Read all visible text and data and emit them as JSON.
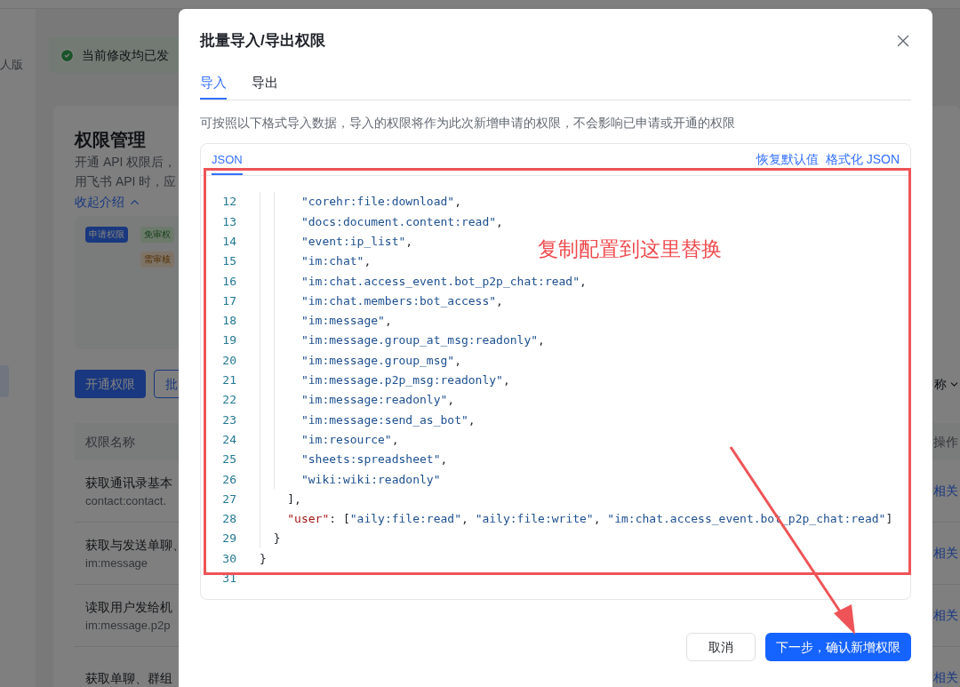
{
  "background_page": {
    "sidebar_label": "人版",
    "banner": {
      "text": "当前修改均已发"
    },
    "card": {
      "title": "权限管理",
      "description_lines": [
        "开通 API 权限后，",
        "用飞书 API 时，应"
      ],
      "collapse_link": "收起介绍",
      "tags": [
        {
          "label": "申请权限",
          "kind": "apply"
        },
        {
          "label": "免审权",
          "kind": "exempt"
        },
        {
          "label": "需审核",
          "kind": "review"
        }
      ],
      "buttons": [
        {
          "label": "开通权限",
          "kind": "primary"
        },
        {
          "label": "批",
          "kind": "outline"
        }
      ],
      "sort_label": "称",
      "table": {
        "columns": [
          "权限名称",
          "操作"
        ],
        "rows": [
          {
            "name": "获取通讯录基本",
            "scope": "contact:contact.",
            "action": "相关"
          },
          {
            "name": "获取与发送单聊、",
            "scope": "im:message",
            "action": "相关"
          },
          {
            "name": "读取用户发给机",
            "scope": "im:message.p2p",
            "action": "相关"
          },
          {
            "name": "获取单聊、群组",
            "action": "相关"
          }
        ]
      }
    }
  },
  "dialog": {
    "title": "批量导入/导出权限",
    "tabs": [
      {
        "label": "导入",
        "selected": true
      },
      {
        "label": "导出",
        "selected": false
      }
    ],
    "description": "可按照以下格式导入数据，导入的权限将作为此次新增申请的权限，不会影响已申请或开通的权限",
    "editor": {
      "tab": {
        "label": "JSON",
        "selected": true
      },
      "actions": [
        "恢复默认值",
        "格式化 JSON"
      ],
      "lines": [
        {
          "number": "12",
          "kind": "array_item",
          "tokens": [
            {
              "kind": "string",
              "text": "\"corehr:file:download\""
            },
            {
              "kind": "punct",
              "text": ","
            }
          ]
        },
        {
          "number": "13",
          "kind": "array_item",
          "tokens": [
            {
              "kind": "string",
              "text": "\"docs:document.content:read\""
            },
            {
              "kind": "punct",
              "text": ","
            }
          ]
        },
        {
          "number": "14",
          "kind": "array_item",
          "tokens": [
            {
              "kind": "string",
              "text": "\"event:ip_list\""
            },
            {
              "kind": "punct",
              "text": ","
            }
          ]
        },
        {
          "number": "15",
          "kind": "array_item",
          "tokens": [
            {
              "kind": "string",
              "text": "\"im:chat\""
            },
            {
              "kind": "punct",
              "text": ","
            }
          ]
        },
        {
          "number": "16",
          "kind": "array_item",
          "tokens": [
            {
              "kind": "string",
              "text": "\"im:chat.access_event.bot_p2p_chat:read\""
            },
            {
              "kind": "punct",
              "text": ","
            }
          ]
        },
        {
          "number": "17",
          "kind": "array_item",
          "tokens": [
            {
              "kind": "string",
              "text": "\"im:chat.members:bot_access\""
            },
            {
              "kind": "punct",
              "text": ","
            }
          ]
        },
        {
          "number": "18",
          "kind": "array_item",
          "tokens": [
            {
              "kind": "string",
              "text": "\"im:message\""
            },
            {
              "kind": "punct",
              "text": ","
            }
          ]
        },
        {
          "number": "19",
          "kind": "array_item",
          "tokens": [
            {
              "kind": "string",
              "text": "\"im:message.group_at_msg:readonly\""
            },
            {
              "kind": "punct",
              "text": ","
            }
          ]
        },
        {
          "number": "20",
          "kind": "array_item",
          "tokens": [
            {
              "kind": "string",
              "text": "\"im:message.group_msg\""
            },
            {
              "kind": "punct",
              "text": ","
            }
          ]
        },
        {
          "number": "21",
          "kind": "array_item",
          "tokens": [
            {
              "kind": "string",
              "text": "\"im:message.p2p_msg:readonly\""
            },
            {
              "kind": "punct",
              "text": ","
            }
          ]
        },
        {
          "number": "22",
          "kind": "array_item",
          "tokens": [
            {
              "kind": "string",
              "text": "\"im:message:readonly\""
            },
            {
              "kind": "punct",
              "text": ","
            }
          ]
        },
        {
          "number": "23",
          "kind": "array_item",
          "tokens": [
            {
              "kind": "string",
              "text": "\"im:message:send_as_bot\""
            },
            {
              "kind": "punct",
              "text": ","
            }
          ]
        },
        {
          "number": "24",
          "kind": "array_item",
          "tokens": [
            {
              "kind": "string",
              "text": "\"im:resource\""
            },
            {
              "kind": "punct",
              "text": ","
            }
          ]
        },
        {
          "number": "25",
          "kind": "array_item",
          "tokens": [
            {
              "kind": "string",
              "text": "\"sheets:spreadsheet\""
            },
            {
              "kind": "punct",
              "text": ","
            }
          ]
        },
        {
          "number": "26",
          "kind": "array_item",
          "tokens": [
            {
              "kind": "string",
              "text": "\"wiki:wiki:readonly\""
            }
          ]
        },
        {
          "number": "27",
          "kind": "array_end",
          "tokens": [
            {
              "kind": "punct",
              "text": "],"
            }
          ]
        },
        {
          "number": "28",
          "kind": "property",
          "tokens": [
            {
              "kind": "key",
              "text": "\"user\""
            },
            {
              "kind": "punct",
              "text": ": ["
            },
            {
              "kind": "string",
              "text": "\"aily:file:read\""
            },
            {
              "kind": "punct",
              "text": ", "
            },
            {
              "kind": "string",
              "text": "\"aily:file:write\""
            },
            {
              "kind": "punct",
              "text": ", "
            },
            {
              "kind": "string",
              "text": "\"im:chat.access_event.bot_p2p_chat:read\""
            },
            {
              "kind": "punct",
              "text": "]"
            }
          ]
        },
        {
          "number": "29",
          "kind": "object_end",
          "tokens": [
            {
              "kind": "punct",
              "text": "}"
            }
          ]
        },
        {
          "number": "30",
          "kind": "root_end",
          "tokens": [
            {
              "kind": "punct",
              "text": "}"
            }
          ]
        },
        {
          "number": "31",
          "kind": "blank"
        }
      ]
    },
    "buttons": [
      {
        "label": "取消",
        "kind": "secondary"
      },
      {
        "label": "下一步，确认新增权限",
        "kind": "primary"
      }
    ]
  },
  "annotation": {
    "text": "复制配置到这里替换"
  }
}
